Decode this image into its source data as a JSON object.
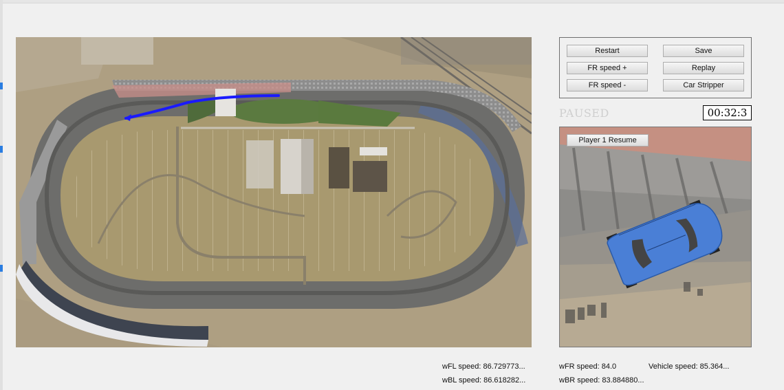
{
  "controls": {
    "restart": "Restart",
    "save": "Save",
    "fr_speed_plus": "FR speed +",
    "replay": "Replay",
    "fr_speed_minus": "FR speed -",
    "car_stripper": "Car Stripper"
  },
  "status": {
    "paused": "PAUSED",
    "timer": "00:32:3"
  },
  "view": {
    "resume": "Player 1 Resume"
  },
  "stats": {
    "wfl": "wFL speed: 86.729773...",
    "wbl": "wBL speed: 86.618282...",
    "wfr": "wFR speed: 84.0",
    "wbr": "wBR speed: 83.884880...",
    "vehicle": "Vehicle speed: 85.364..."
  },
  "colors": {
    "path": "#1a1aff",
    "car": "#4a7fd6"
  },
  "icons": {
    "path_arrow": "arrow-left"
  }
}
